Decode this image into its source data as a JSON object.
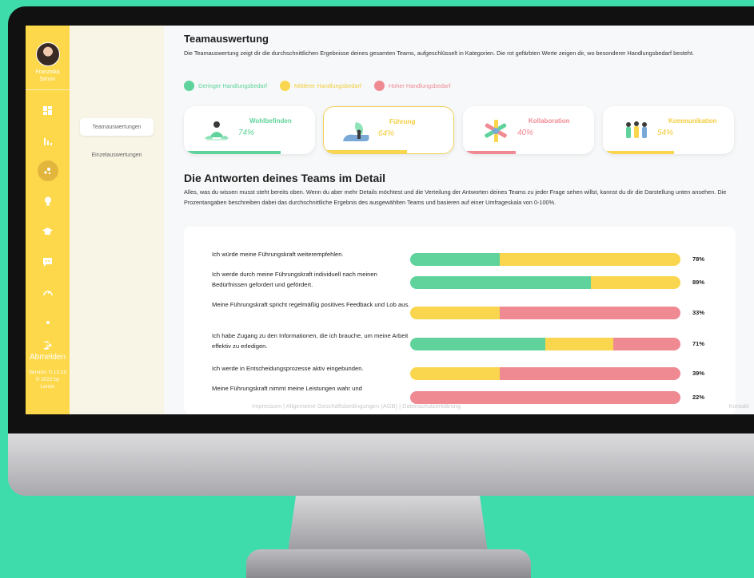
{
  "user": {
    "first_name": "Franziska",
    "last_name": "Simon"
  },
  "sidebar": {
    "icons": [
      "dashboard-icon",
      "chart-icon",
      "network-icon",
      "bulb-icon",
      "graduation-icon",
      "chat-icon",
      "speedometer-icon",
      "dot-icon"
    ],
    "logout_label": "Abmelden",
    "version": "Version: 0.13.15",
    "copyright": "© 2022 by",
    "company": "Lemin"
  },
  "nav": {
    "items": [
      "Teamauswertungen",
      "Einzelauswertungen"
    ]
  },
  "main": {
    "title": "Teamauswertung",
    "description": "Die Teamauswertung zeigt dir die durchschnittlichen Ergebnisse deines gesamten Teams, aufgeschlüsselt in Kategorien. Die rot gefärbten Werte zeigen dir, wo besonderer Handlungsbedarf besteht.",
    "legend": [
      {
        "label": "Geringer Handlungsbedarf",
        "color": "#5fd39b"
      },
      {
        "label": "Mittlerer Handlungsbedarf",
        "color": "#f9d64d"
      },
      {
        "label": "Hoher Handlungsbedarf",
        "color": "#ef8a93"
      }
    ],
    "categories": [
      {
        "title": "Wohlbefinden",
        "value": "74%",
        "percent": 74,
        "color": "#5fd39b",
        "selected": false
      },
      {
        "title": "Führung",
        "value": "64%",
        "percent": 64,
        "color": "#f9d64d",
        "selected": true
      },
      {
        "title": "Kollaboration",
        "value": "40%",
        "percent": 40,
        "color": "#ef8a93",
        "selected": false
      },
      {
        "title": "Kommunikation",
        "value": "54%",
        "percent": 54,
        "color": "#f9d64d",
        "selected": false
      }
    ],
    "detail_title": "Die Antworten deines Teams im Detail",
    "detail_description": "Alles, was du wissen musst steht bereits oben. Wenn du aber mehr Details möchtest und die Verteilung der Antworten deines Teams zu jeder Frage sehen willst, kannst du dir die Darstellung unten ansehen. Die Prozentangaben beschreiben dabei das durchschnittliche Ergebnis des ausgewählten Teams und basieren auf einer Umfrageskala von 0-100%.",
    "questions": [
      {
        "text": "Ich würde meine Führungskraft weiterempfehlen.",
        "percent": "78%",
        "green": 0.33,
        "yellow": 0.67,
        "red": 0
      },
      {
        "text": "Ich werde durch meine Führungskraft individuell nach meinen Bedürfnissen gefordert und gefördert.",
        "percent": "89%",
        "green": 0.67,
        "yellow": 0.33,
        "red": 0
      },
      {
        "text": "Meine Führungskraft spricht regelmäßig positives Feedback und Lob aus.",
        "percent": "33%",
        "green": 0,
        "yellow": 0.33,
        "red": 0.67
      },
      {
        "text": "Ich habe Zugang zu den Informationen, die ich brauche, um meine Arbeit effektiv zu erledigen.",
        "percent": "71%",
        "green": 0.5,
        "yellow": 0.25,
        "red": 0.25
      },
      {
        "text": "Ich werde in Entscheidungsprozesse aktiv eingebunden.",
        "percent": "39%",
        "green": 0,
        "yellow": 0.33,
        "red": 0.67
      },
      {
        "text": "Meine Führungskraft nimmt meine Leistungen wahr und",
        "percent": "22%",
        "green": 0,
        "yellow": 0,
        "red": 1
      }
    ]
  },
  "footer": {
    "links": "Impressum  |  Allgemeine Geschäftsbedingungen (AGB)  |  Datenschutzerklärung",
    "contact": "Kontakt"
  }
}
